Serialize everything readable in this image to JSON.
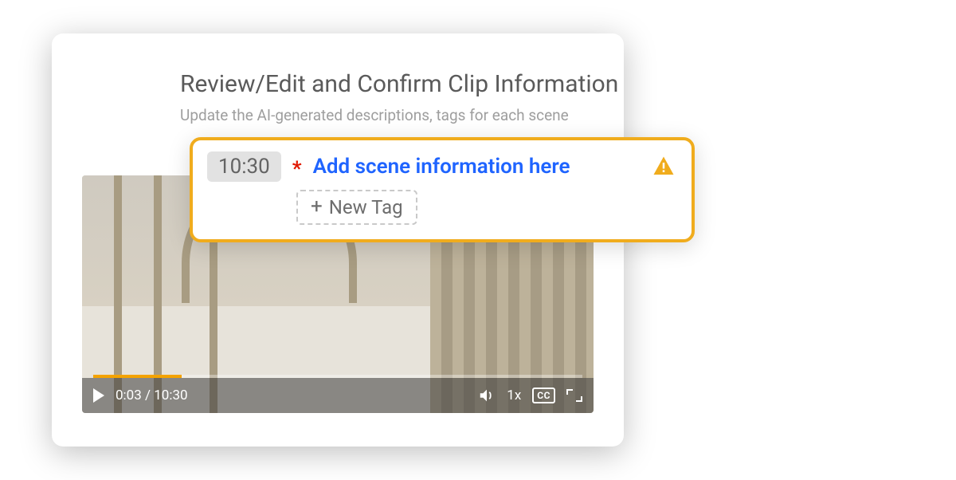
{
  "header": {
    "title": "Review/Edit and Confirm Clip Information",
    "subtitle": "Update the AI-generated descriptions, tags for each scene"
  },
  "video": {
    "current_time": "0:03",
    "duration": "10:30",
    "time_display": "0:03 / 10:30",
    "played_percent": 18,
    "playback_rate_label": "1x",
    "cc_label": "CC"
  },
  "popup": {
    "timestamp": "10:30",
    "required_marker": "*",
    "scene_placeholder": "Add scene information here",
    "new_tag_label": "New Tag",
    "plus_glyph": "+"
  }
}
